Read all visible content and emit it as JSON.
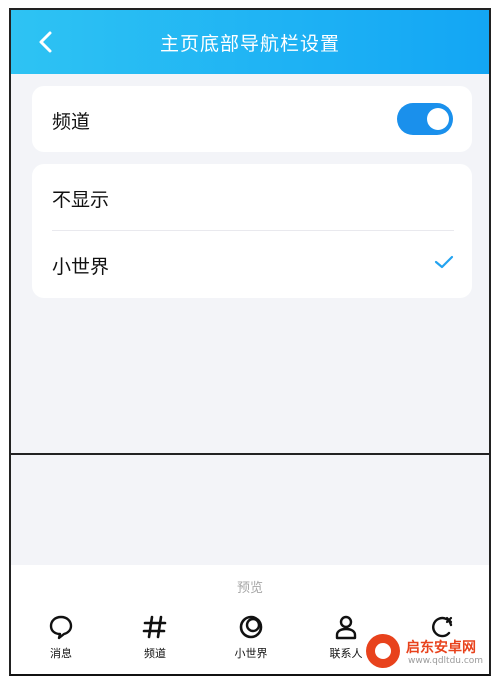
{
  "header": {
    "title": "主页底部导航栏设置",
    "back_icon": "chevron-left-icon",
    "gradient": [
      "#2ec3f3",
      "#13a6f4"
    ]
  },
  "channel_setting": {
    "label": "频道",
    "enabled": true,
    "toggle_color": "#1a90ec"
  },
  "options": [
    {
      "label": "不显示",
      "selected": false
    },
    {
      "label": "小世界",
      "selected": true
    }
  ],
  "preview": {
    "label": "预览",
    "tabs": [
      {
        "label": "消息",
        "icon": "chat-bubble-icon"
      },
      {
        "label": "频道",
        "icon": "hashtag-icon"
      },
      {
        "label": "小世界",
        "icon": "world-ring-icon"
      },
      {
        "label": "联系人",
        "icon": "person-icon"
      },
      {
        "label": "",
        "icon": "refresh-icon"
      }
    ]
  },
  "watermark": {
    "name": "启东安卓网",
    "url": "www.qdltdu.com"
  }
}
